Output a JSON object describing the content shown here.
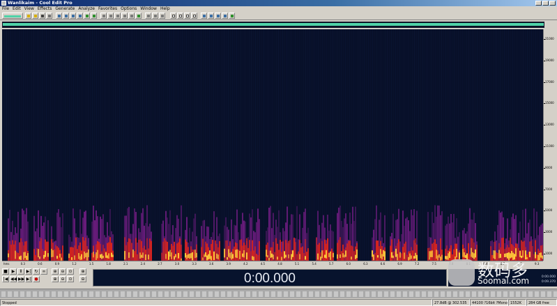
{
  "window": {
    "title": "Wanlikaim - Cool Edit Pro"
  },
  "menu": [
    "File",
    "Edit",
    "View",
    "Effects",
    "Generate",
    "Analyze",
    "Favorites",
    "Options",
    "Window",
    "Help"
  ],
  "toolbar": {
    "buttons": [
      "waveform-view",
      "open",
      "save",
      "cut",
      "copy",
      "paste",
      "undo",
      "mix-paste",
      "select-all",
      "zoom",
      "spectral-view",
      "edit-mode",
      "multitrack-mode",
      "play-looped",
      "properties",
      "settings",
      "scripts",
      "cue-list",
      "help"
    ]
  },
  "spectrogram": {
    "freq_ticks": [
      "21000",
      "19000",
      "17000",
      "15000",
      "13000",
      "11000",
      "9000",
      "7000",
      "5000",
      "3000",
      "1000"
    ]
  },
  "timeline": {
    "ticks": [
      "hms",
      "0.3",
      "0.6",
      "0.9",
      "1.2",
      "1.5",
      "1.8",
      "2.1",
      "2.4",
      "2.7",
      "3.0",
      "3.3",
      "3.6",
      "3.9",
      "4.2",
      "4.5",
      "4.8",
      "5.1",
      "5.4",
      "5.7",
      "6.0",
      "6.3",
      "6.6",
      "6.9",
      "7.2",
      "7.5",
      "7.8",
      "8.1",
      "8.4",
      "8.7",
      "9.0",
      "9.3"
    ]
  },
  "transport": {
    "buttons": [
      "stop",
      "play",
      "pause",
      "play-to-end",
      "play-looped",
      "record",
      "go-to-start",
      "rewind",
      "fast-forward",
      "go-to-end"
    ]
  },
  "time_display": "0:00.000",
  "selection": {
    "begin": "0:00.000",
    "end": "0:09.370"
  },
  "watermark": {
    "text": "数码多",
    "site": "Soomal.com"
  },
  "status": {
    "state": "Stopped",
    "cursor": "27.8dB @ 302.535",
    "format": "44100 ?16bit ?Mono",
    "size": "1552K",
    "free": "284 GB free"
  },
  "colors": {
    "spectrogram_bg": "#081029",
    "overview_bar": "#4fd3a8",
    "time_display_bg": "#07132d"
  }
}
